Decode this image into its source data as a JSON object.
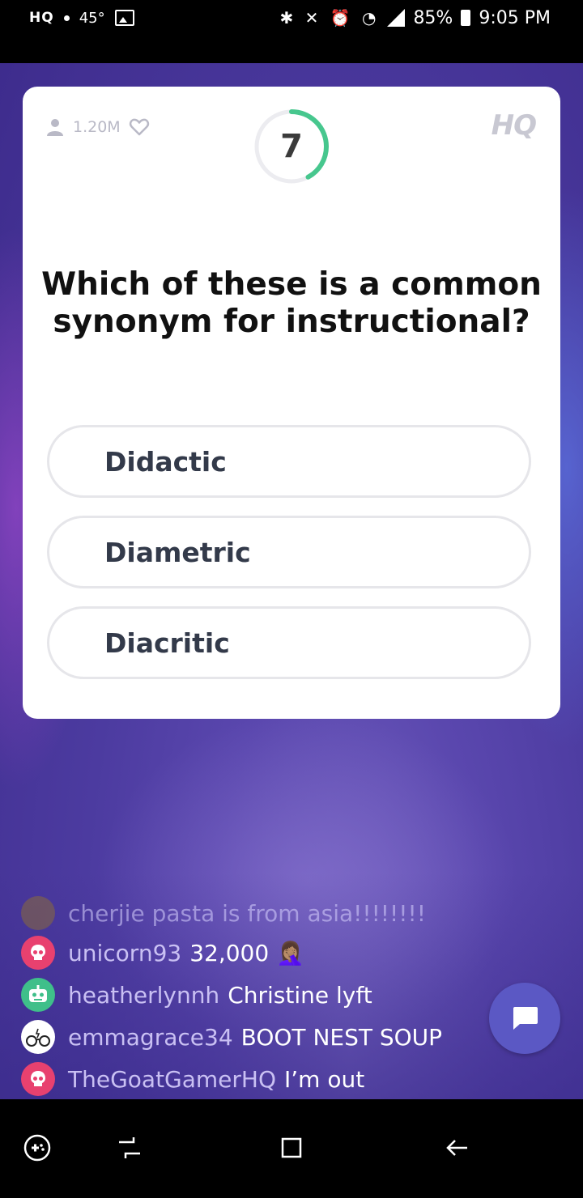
{
  "status_bar": {
    "app_logo": "HQ",
    "temperature": "45°",
    "battery": "85%",
    "time": "9:05 PM"
  },
  "card": {
    "viewer_count": "1.20M",
    "timer": "7",
    "timer_progress": 0.42,
    "logo": "HQ",
    "question": "Which of these is a common synonym for instructional?",
    "answers": [
      "Didactic",
      "Diametric",
      "Diacritic"
    ]
  },
  "chat": {
    "messages": [
      {
        "user": "",
        "text": "cherjie pasta is from asia!!!!!!!!",
        "avatar": "photo",
        "avatar_color": "#8a6a3a"
      },
      {
        "user": "unicorn93",
        "text": "32,000 🤦🏽‍♀️",
        "avatar": "skull-icon",
        "avatar_color": "#e8416f"
      },
      {
        "user": "heatherlynnh",
        "text": "Christine lyft",
        "avatar": "robot-icon",
        "avatar_color": "#3fbf8a"
      },
      {
        "user": "emmagrace34",
        "text": "BOOT NEST SOUP",
        "avatar": "glasses-icon",
        "avatar_color": "#ffffff"
      },
      {
        "user": "TheGoatGamerHQ",
        "text": "I’m out",
        "avatar": "skull-icon",
        "avatar_color": "#e8416f"
      }
    ]
  },
  "colors": {
    "accent": "#5b58c4",
    "timer_ring": "#47c78e",
    "background": "#4c3ba0"
  }
}
